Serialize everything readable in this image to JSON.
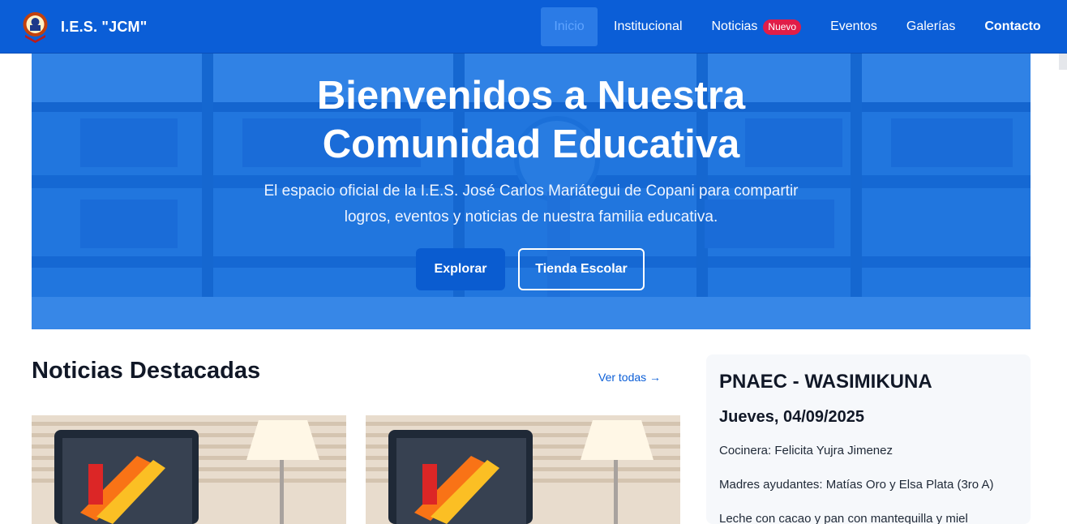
{
  "brand": {
    "name": "I.E.S. \"JCM\""
  },
  "nav": {
    "items": [
      {
        "label": "Inicio"
      },
      {
        "label": "Institucional"
      },
      {
        "label": "Noticias",
        "badge": "Nuevo"
      },
      {
        "label": "Eventos"
      },
      {
        "label": "Galerías"
      },
      {
        "label": "Contacto"
      }
    ]
  },
  "hero": {
    "title": "Bienvenidos a Nuestra Comunidad Educativa",
    "subtitle": "El espacio oficial de la I.E.S. José Carlos Mariátegui de Copani para compartir logros, eventos y noticias de nuestra familia educativa.",
    "primary_button": "Explorar",
    "secondary_button": "Tienda Escolar"
  },
  "news": {
    "title": "Noticias Destacadas",
    "see_all": "Ver todas →"
  },
  "side": {
    "title": "PNAEC - WASIMIKUNA",
    "date": "Jueves, 04/09/2025",
    "lines": [
      "Cocinera: Felicita Yujra Jimenez",
      "Madres ayudantes: Matías Oro y Elsa Plata (3ro A)",
      "Leche con cacao y pan con mantequilla y miel"
    ]
  },
  "colors": {
    "primary": "#0b5ed7",
    "badge": "#e11d48"
  }
}
